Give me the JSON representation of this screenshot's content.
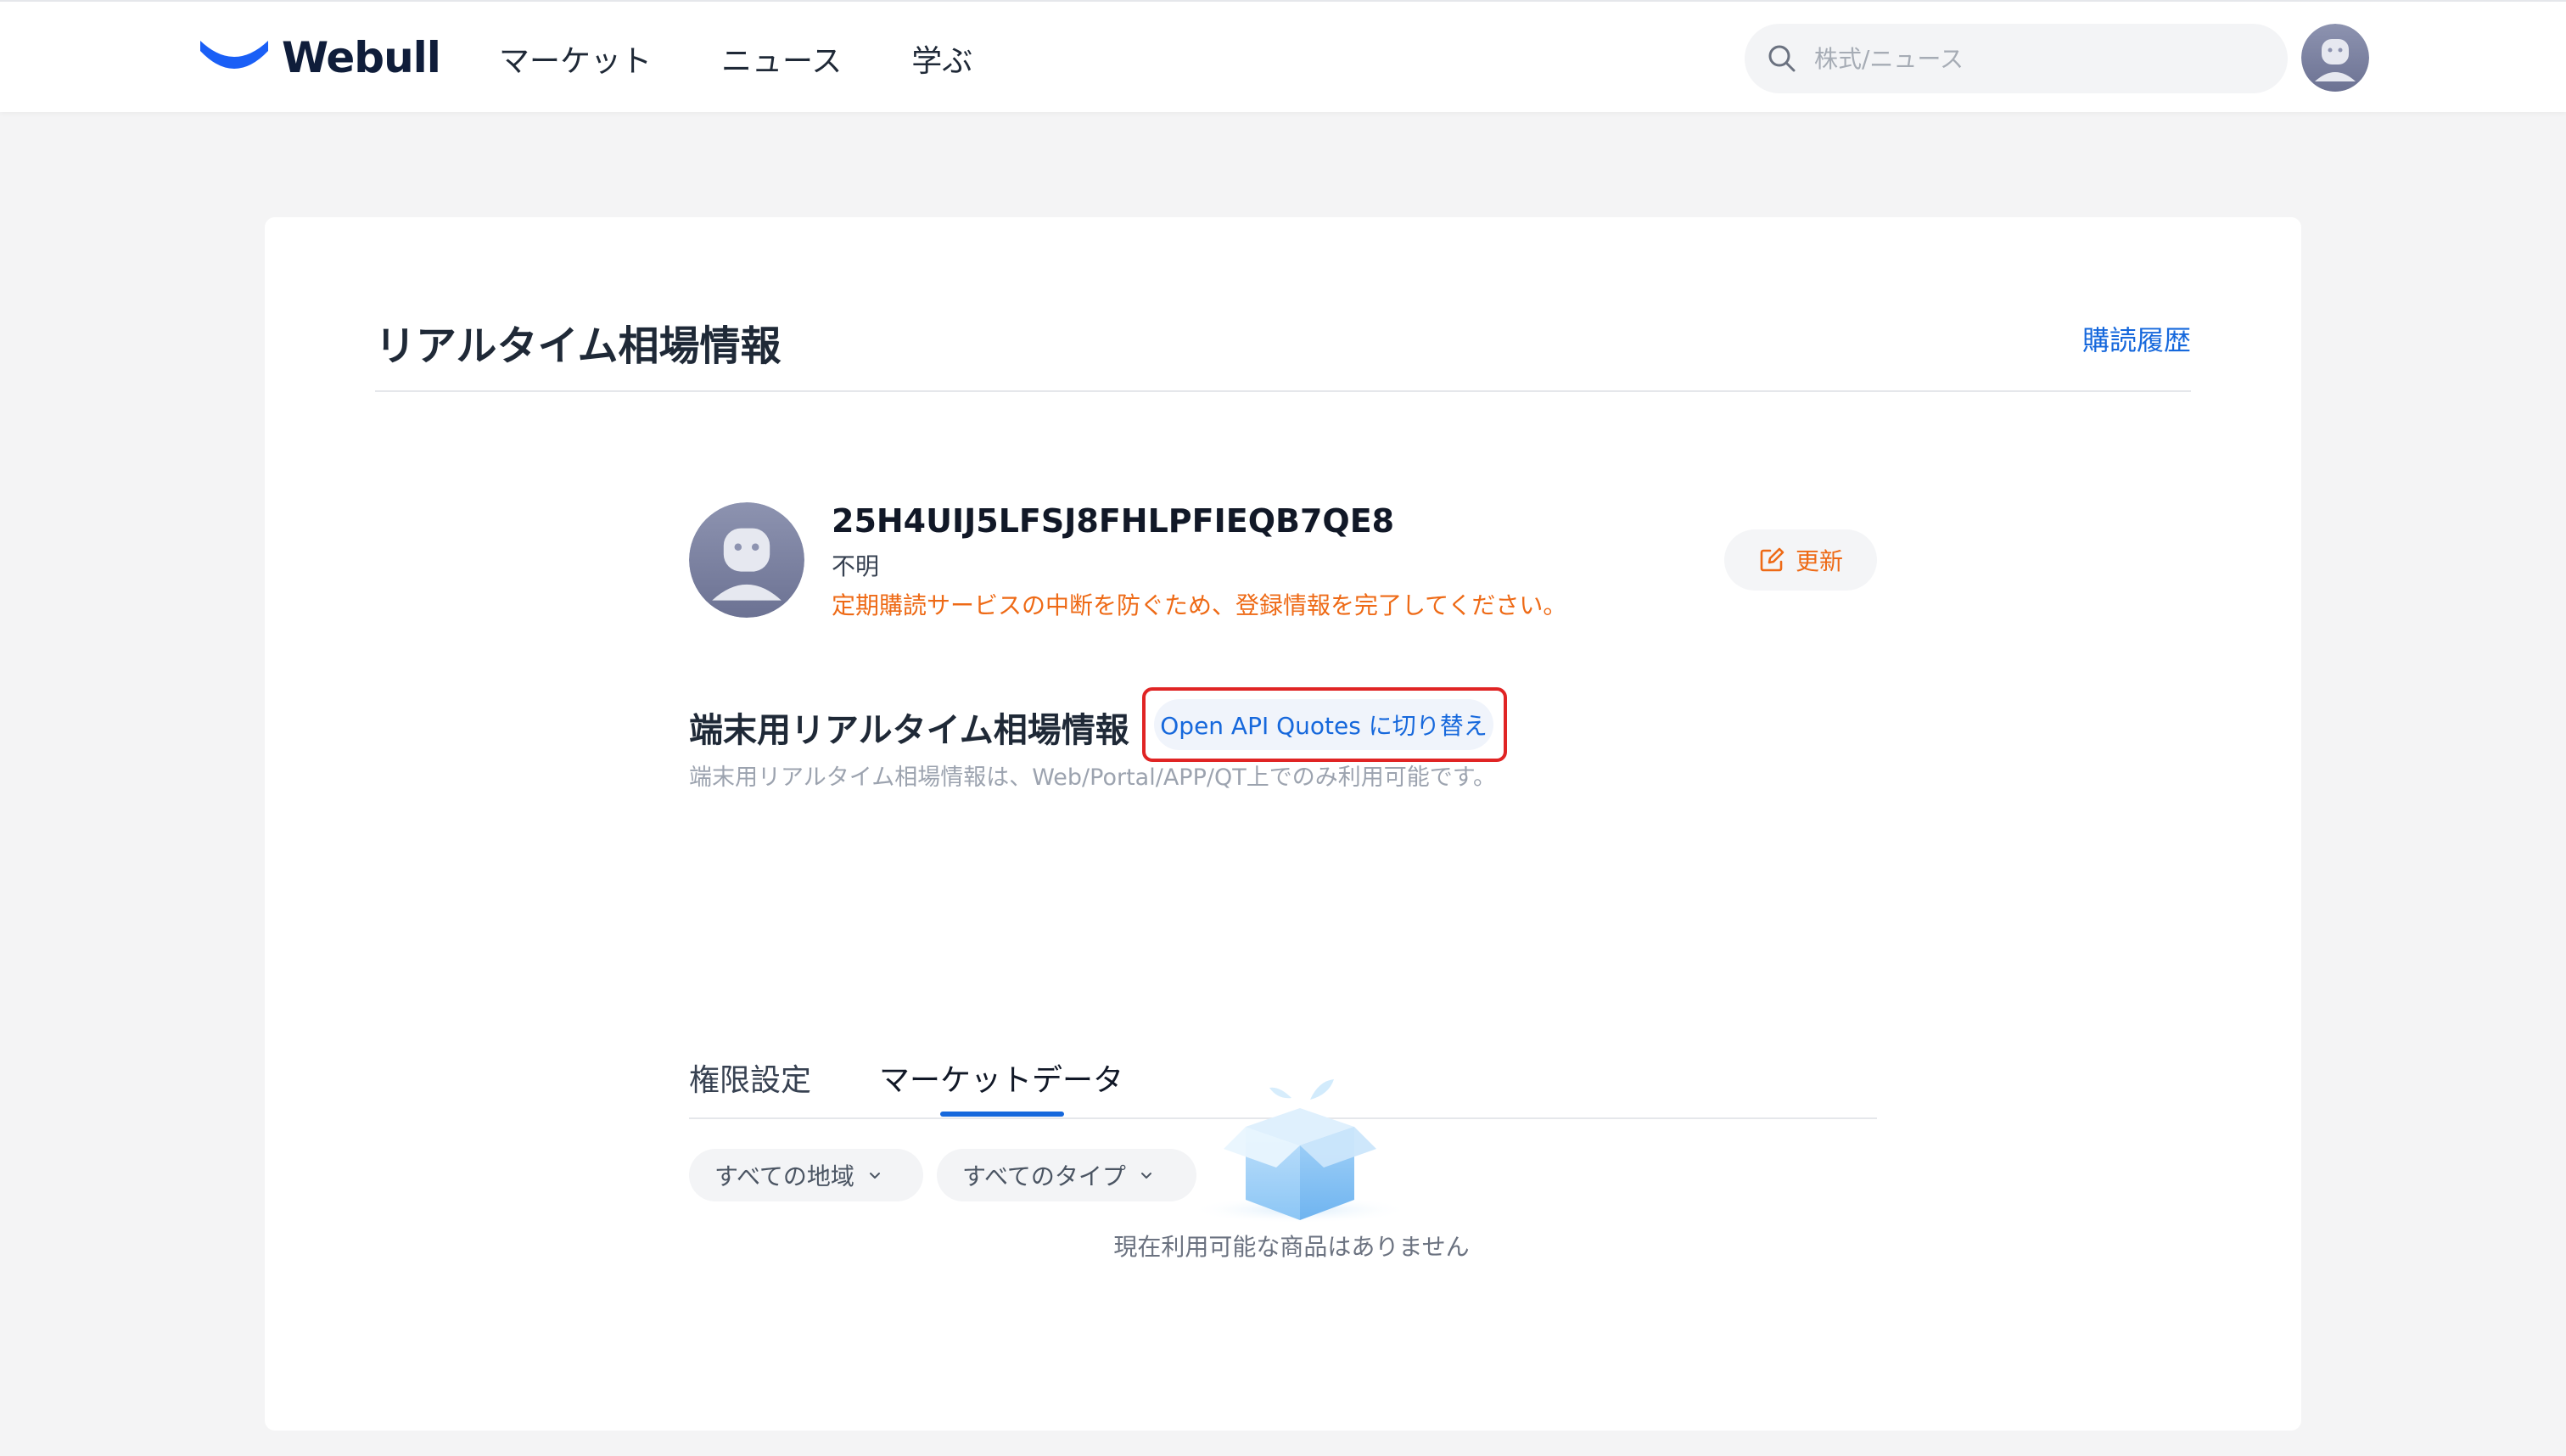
{
  "header": {
    "brand": "Webull",
    "nav": [
      "マーケット",
      "ニュース",
      "学ぶ"
    ],
    "search_placeholder": "株式/ニュース"
  },
  "page": {
    "title": "リアルタイム相場情報",
    "history_link": "購読履歴"
  },
  "profile": {
    "id": "25H4UIJ5LFSJ8FHLPFIEQB7QE8",
    "status": "不明",
    "warning": "定期購読サービスの中断を防ぐため、登録情報を完了してください。",
    "update_label": "更新"
  },
  "section": {
    "title": "端末用リアルタイム相場情報",
    "switch_label": "Open API Quotes に切り替え",
    "description": "端末用リアルタイム相場情報は、Web/Portal/APP/QT上でのみ利用可能です。"
  },
  "tabs": [
    {
      "label": "権限設定",
      "active": false
    },
    {
      "label": "マーケットデータ",
      "active": true
    }
  ],
  "filters": {
    "region": "すべての地域",
    "type": "すべてのタイプ"
  },
  "empty_state": {
    "message": "現在利用可能な商品はありません"
  },
  "colors": {
    "accent_blue": "#1668dc",
    "warning_orange": "#ee6a16",
    "highlight_red": "#e02424"
  }
}
